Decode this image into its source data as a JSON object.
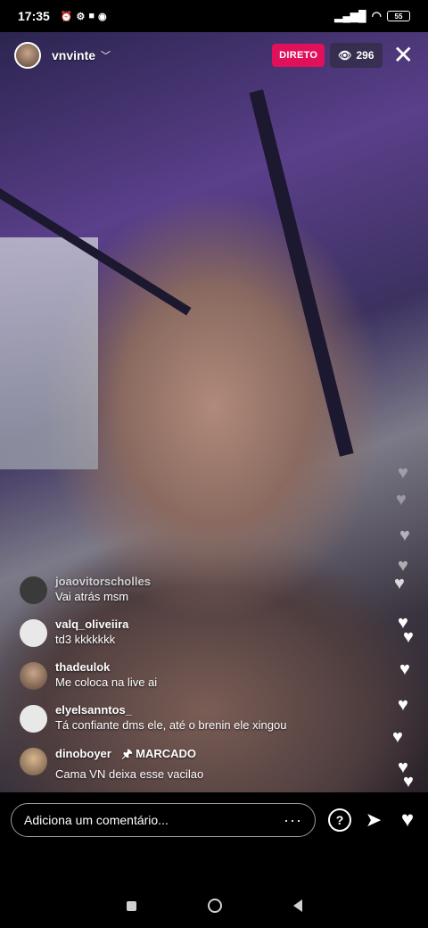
{
  "status_bar": {
    "time": "17:35",
    "left_icons": [
      "alarm-icon",
      "settings-icon",
      "camera-icon",
      "vpn-icon"
    ],
    "battery": "55"
  },
  "header": {
    "username": "vnvinte",
    "live_label": "DIRETO",
    "viewer_count": "296"
  },
  "comments": [
    {
      "user": "joaovitorscholles",
      "text": "Vai atrás msm",
      "avatar_color": "#3a3a3a",
      "faded": true
    },
    {
      "user": "valq_oliveiira",
      "text": "td3 kkkkkkk",
      "avatar_color": "#e8e8e8"
    },
    {
      "user": "thadeulok",
      "text": "Me coloca na live ai",
      "avatar_color": "#8a6f6a"
    },
    {
      "user": "elyelsanntos_",
      "text": "Tá confiante dms ele,  até o brenin ele xingou",
      "avatar_color": "#e8e8e8"
    },
    {
      "user": "dinoboyer",
      "pinned_label": "MARCADO",
      "text": "Cama VN deixa esse vacilao",
      "avatar_color": "#9a7c60"
    }
  ],
  "bottom": {
    "comment_placeholder": "Adiciona um comentário..."
  },
  "colors": {
    "live_badge": "#e0105a"
  }
}
